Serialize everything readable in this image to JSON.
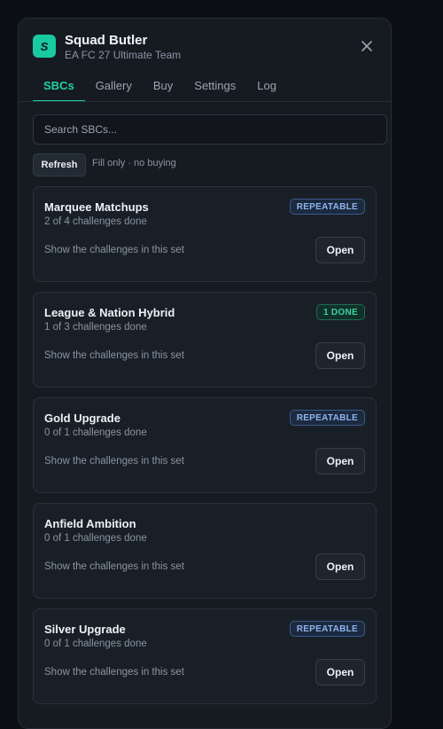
{
  "app": {
    "title": "Squad Butler",
    "subtitle": "EA FC 27 Ultimate Team",
    "logo_letter": "S",
    "accent_color": "#1fd1a6"
  },
  "tabs": [
    {
      "label": "SBCs",
      "active": true
    },
    {
      "label": "Gallery",
      "active": false
    },
    {
      "label": "Buy",
      "active": false
    },
    {
      "label": "Settings",
      "active": false
    },
    {
      "label": "Log",
      "active": false
    }
  ],
  "search": {
    "placeholder": "Search SBCs...",
    "value": ""
  },
  "toolbar": {
    "refresh_label": "Refresh",
    "filter_note": "Fill only · no buying"
  },
  "sbcs": [
    {
      "title": "Marquee Matchups",
      "progress": "2 of 4 challenges done",
      "description": "Show the challenges in this set",
      "badge": "REPEATABLE",
      "badge_type": "repeatable",
      "open_label": "Open"
    },
    {
      "title": "League & Nation Hybrid",
      "progress": "1 of 3 challenges done",
      "description": "Show the challenges in this set",
      "badge": "1 DONE",
      "badge_type": "done",
      "open_label": "Open"
    },
    {
      "title": "Gold Upgrade",
      "progress": "0 of 1 challenges done",
      "description": "Show the challenges in this set",
      "badge": "REPEATABLE",
      "badge_type": "repeatable",
      "open_label": "Open"
    },
    {
      "title": "Anfield Ambition",
      "progress": "0 of 1 challenges done",
      "description": "Show the challenges in this set",
      "badge": "",
      "badge_type": "none",
      "open_label": "Open"
    },
    {
      "title": "Silver Upgrade",
      "progress": "0 of 1 challenges done",
      "description": "Show the challenges in this set",
      "badge": "REPEATABLE",
      "badge_type": "repeatable",
      "open_label": "Open"
    }
  ],
  "icons": {
    "close": "close-icon",
    "logo": "logo-icon"
  }
}
